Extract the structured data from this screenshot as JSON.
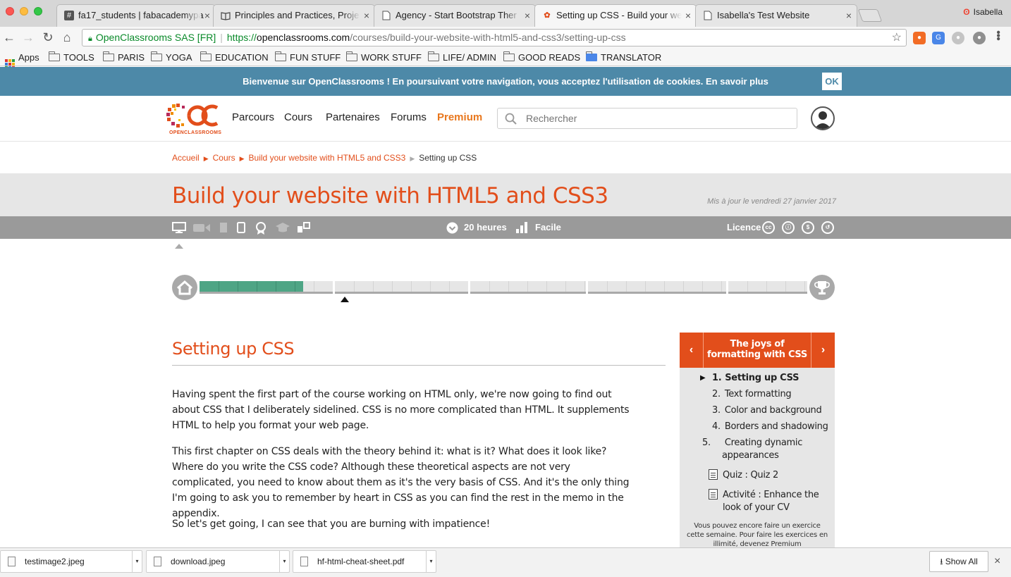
{
  "browser": {
    "tabs": [
      {
        "title": "fa17_students | fabacademypa",
        "favicon": "hash-icon"
      },
      {
        "title": "Principles and Practices, Proje",
        "favicon": "book-icon"
      },
      {
        "title": "Agency - Start Bootstrap Ther",
        "favicon": "page-icon"
      },
      {
        "title": "Setting up CSS - Build your we",
        "favicon": "oc-icon",
        "active": true
      },
      {
        "title": "Isabella's Test Website",
        "favicon": "page-icon"
      }
    ],
    "profile_name": "Isabella",
    "url": {
      "security_label": "OpenClassrooms SAS [FR]",
      "scheme": "https://",
      "host": "openclassrooms.com",
      "path": "/courses/build-your-website-with-html5-and-css3/setting-up-css"
    },
    "bookmarks": [
      "Apps",
      "TOOLS",
      "PARIS",
      "YOGA",
      "EDUCATION",
      "FUN STUFF",
      "WORK STUFF",
      "LIFE/ ADMIN",
      "GOOD READS",
      "TRANSLATOR"
    ]
  },
  "cookie_banner": {
    "text": "Bienvenue sur OpenClassrooms ! En poursuivant votre navigation, vous acceptez l'utilisation de cookies. En savoir plus",
    "ok_label": "OK"
  },
  "header": {
    "logo_text": "OPENCLASSROOMS",
    "nav": [
      "Parcours",
      "Cours",
      "Partenaires",
      "Forums",
      "Premium"
    ],
    "search_placeholder": "Rechercher"
  },
  "breadcrumb": {
    "items": [
      "Accueil",
      "Cours",
      "Build your website with HTML5 and CSS3"
    ],
    "current": "Setting up CSS"
  },
  "course": {
    "title": "Build your website with HTML5 and CSS3",
    "updated": "Mis à jour le vendredi 27 janvier 2017",
    "duration": "20 heures",
    "level": "Facile",
    "licence_label": "Licence",
    "progress_fraction": 0.17
  },
  "chapter": {
    "title": "Setting up CSS",
    "paragraphs": [
      "Having spent the first part of the course working on HTML only, we're now going to find out about CSS that I deliberately sidelined. CSS is no more complicated than HTML. It supplements HTML to help you format your web page.",
      "This first chapter on CSS deals with the theory behind it: what is it? What does it look like? Where do you write the CSS code? Although these theoretical aspects are not very complicated, you need to know about them as it's the very basis of CSS. And it's the only thing I'm going to ask you to remember by heart in CSS as you can find the rest in the memo in the appendix.",
      "So let's get going, I can see that you are burning with impatience!"
    ]
  },
  "sidebar": {
    "part_title": "The joys of formatting with CSS",
    "chapters": [
      {
        "num": "1.",
        "label": "Setting up CSS"
      },
      {
        "num": "2.",
        "label": "Text formatting"
      },
      {
        "num": "3.",
        "label": "Color and background"
      },
      {
        "num": "4.",
        "label": "Borders and shadowing"
      },
      {
        "num": "5.",
        "label": "Creating dynamic appearances"
      }
    ],
    "quiz": "Quiz : Quiz 2",
    "activity": "Activité : Enhance the look of your CV",
    "note": "Vous pouvez encore faire un exercice cette semaine. Pour faire les exercices en illimité, devenez Premium"
  },
  "downloads": {
    "files": [
      "testimage2.jpeg",
      "download.jpeg",
      "hf-html-cheat-sheet.pdf"
    ],
    "show_all": "Show All"
  },
  "colors": {
    "accent": "#e24e1b",
    "premium": "#e8771d",
    "cookie_bar": "#4d89a8",
    "progress_done": "#4ea585",
    "info_bar": "#9a9a9a"
  }
}
